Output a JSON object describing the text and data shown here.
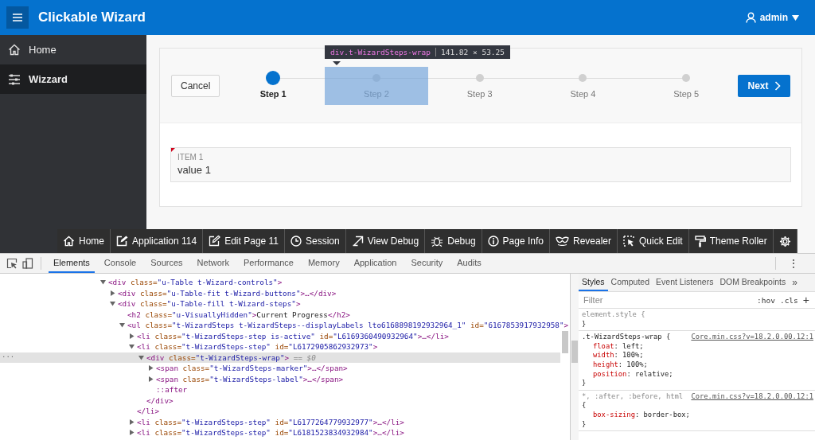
{
  "header": {
    "title": "Clickable Wizard",
    "user": "admin"
  },
  "sidebar": {
    "items": [
      {
        "label": "Home",
        "selected": false
      },
      {
        "label": "Wizzard",
        "selected": true
      }
    ]
  },
  "wizard": {
    "cancel": "Cancel",
    "next": "Next",
    "steps": [
      {
        "label": "Step 1",
        "selected": true,
        "highlighted": false
      },
      {
        "label": "Step 2",
        "selected": false,
        "highlighted": true
      },
      {
        "label": "Step 3",
        "selected": false,
        "highlighted": false
      },
      {
        "label": "Step 4",
        "selected": false,
        "highlighted": false
      },
      {
        "label": "Step 5",
        "selected": false,
        "highlighted": false
      }
    ],
    "inspector_tooltip": {
      "selector": "div.t-WizardSteps-wrap",
      "size": "141.82 × 53.25"
    }
  },
  "form": {
    "label": "ITEM 1",
    "value": "value 1"
  },
  "developer_toolbar": [
    {
      "label": "Home"
    },
    {
      "label": "Application 114"
    },
    {
      "label": "Edit Page 11"
    },
    {
      "label": "Session"
    },
    {
      "label": "View Debug"
    },
    {
      "label": "Debug"
    },
    {
      "label": "Page Info"
    },
    {
      "label": "Revealer"
    },
    {
      "label": "Quick Edit"
    },
    {
      "label": "Theme Roller"
    }
  ],
  "devtools": {
    "tabs": [
      {
        "label": "Elements",
        "selected": true
      },
      {
        "label": "Console",
        "selected": false
      },
      {
        "label": "Sources",
        "selected": false
      },
      {
        "label": "Network",
        "selected": false
      },
      {
        "label": "Performance",
        "selected": false
      },
      {
        "label": "Memory",
        "selected": false
      },
      {
        "label": "Application",
        "selected": false
      },
      {
        "label": "Security",
        "selected": false
      },
      {
        "label": "Audits",
        "selected": false
      }
    ],
    "more": "⋮",
    "dom_tree": [
      {
        "expanded": true,
        "selected": false,
        "tokens": [
          {
            "kind": "tag",
            "text": "<div"
          },
          {
            "kind": "attr",
            "text": " class="
          },
          {
            "kind": "value",
            "text": "\"u-Table t-Wizard-controls\""
          },
          {
            "kind": "tag",
            "text": ">"
          }
        ],
        "children": [
          {
            "expanded": false,
            "selected": false,
            "tokens": [
              {
                "kind": "tag",
                "text": "<div"
              },
              {
                "kind": "attr",
                "text": " class="
              },
              {
                "kind": "value",
                "text": "\"u-Table-fit t-Wizard-buttons\""
              },
              {
                "kind": "tag",
                "text": ">…</div>"
              }
            ]
          },
          {
            "expanded": true,
            "selected": false,
            "tokens": [
              {
                "kind": "tag",
                "text": "<div"
              },
              {
                "kind": "attr",
                "text": " class="
              },
              {
                "kind": "value",
                "text": "\"u-Table-fill t-Wizard-steps\""
              },
              {
                "kind": "tag",
                "text": ">"
              }
            ],
            "children": [
              {
                "tokens": [
                  {
                    "kind": "tag",
                    "text": "<h2"
                  },
                  {
                    "kind": "attr",
                    "text": " class="
                  },
                  {
                    "kind": "value",
                    "text": "\"u-VisuallyHidden\""
                  },
                  {
                    "kind": "tag",
                    "text": ">"
                  },
                  {
                    "kind": "text",
                    "text": "Current Progress"
                  },
                  {
                    "kind": "tag",
                    "text": "</h2>"
                  }
                ],
                "selected": false
              },
              {
                "expanded": true,
                "selected": false,
                "tokens": [
                  {
                    "kind": "tag",
                    "text": "<ul"
                  },
                  {
                    "kind": "attr",
                    "text": " class="
                  },
                  {
                    "kind": "value",
                    "text": "\"t-WizardSteps t-WizardSteps--displayLabels lto6168898192932964_1\""
                  },
                  {
                    "kind": "attr",
                    "text": " id="
                  },
                  {
                    "kind": "value",
                    "text": "\"6167853917932958\""
                  },
                  {
                    "kind": "tag",
                    "text": ">"
                  }
                ],
                "children": [
                  {
                    "expanded": false,
                    "selected": false,
                    "tokens": [
                      {
                        "kind": "tag",
                        "text": "<li"
                      },
                      {
                        "kind": "attr",
                        "text": " class="
                      },
                      {
                        "kind": "value",
                        "text": "\"t-WizardSteps-step is-active\""
                      },
                      {
                        "kind": "attr",
                        "text": " id="
                      },
                      {
                        "kind": "value",
                        "text": "\"L6169360490932964\""
                      },
                      {
                        "kind": "tag",
                        "text": ">…</li>"
                      }
                    ]
                  },
                  {
                    "expanded": true,
                    "selected": false,
                    "tokens": [
                      {
                        "kind": "tag",
                        "text": "<li"
                      },
                      {
                        "kind": "attr",
                        "text": " class="
                      },
                      {
                        "kind": "value",
                        "text": "\"t-WizardSteps-step\""
                      },
                      {
                        "kind": "attr",
                        "text": " id="
                      },
                      {
                        "kind": "value",
                        "text": "\"L6172905862932973\""
                      },
                      {
                        "kind": "tag",
                        "text": ">"
                      }
                    ],
                    "close": "</li>",
                    "children": [
                      {
                        "expanded": true,
                        "selected": true,
                        "tokens": [
                          {
                            "kind": "tag",
                            "text": "<div"
                          },
                          {
                            "kind": "attr",
                            "text": " class="
                          },
                          {
                            "kind": "value",
                            "text": "\"t-WizardSteps-wrap\""
                          },
                          {
                            "kind": "tag",
                            "text": ">"
                          },
                          {
                            "kind": "dim",
                            "text": " == $0"
                          }
                        ],
                        "close": "</div>",
                        "children": [
                          {
                            "expanded": false,
                            "selected": false,
                            "tokens": [
                              {
                                "kind": "tag",
                                "text": "<span"
                              },
                              {
                                "kind": "attr",
                                "text": " class="
                              },
                              {
                                "kind": "value",
                                "text": "\"t-WizardSteps-marker\""
                              },
                              {
                                "kind": "tag",
                                "text": ">…</span>"
                              }
                            ]
                          },
                          {
                            "expanded": false,
                            "selected": false,
                            "tokens": [
                              {
                                "kind": "tag",
                                "text": "<span"
                              },
                              {
                                "kind": "attr",
                                "text": " class="
                              },
                              {
                                "kind": "value",
                                "text": "\"t-WizardSteps-label\""
                              },
                              {
                                "kind": "tag",
                                "text": ">…</span>"
                              }
                            ]
                          },
                          {
                            "selected": false,
                            "tokens": [
                              {
                                "kind": "pseudo",
                                "text": "::after"
                              }
                            ]
                          }
                        ]
                      }
                    ]
                  },
                  {
                    "expanded": false,
                    "selected": false,
                    "tokens": [
                      {
                        "kind": "tag",
                        "text": "<li"
                      },
                      {
                        "kind": "attr",
                        "text": " class="
                      },
                      {
                        "kind": "value",
                        "text": "\"t-WizardSteps-step\""
                      },
                      {
                        "kind": "attr",
                        "text": " id="
                      },
                      {
                        "kind": "value",
                        "text": "\"L6177264779932977\""
                      },
                      {
                        "kind": "tag",
                        "text": ">…</li>"
                      }
                    ]
                  },
                  {
                    "expanded": false,
                    "selected": false,
                    "tokens": [
                      {
                        "kind": "tag",
                        "text": "<li"
                      },
                      {
                        "kind": "attr",
                        "text": " class="
                      },
                      {
                        "kind": "value",
                        "text": "\"t-WizardSteps-step\""
                      },
                      {
                        "kind": "attr",
                        "text": " id="
                      },
                      {
                        "kind": "value",
                        "text": "\"L6181523834932984\""
                      },
                      {
                        "kind": "tag",
                        "text": ">…</li>"
                      }
                    ]
                  }
                ]
              }
            ]
          }
        ]
      }
    ],
    "selected_marker": "...",
    "styles": {
      "tabs": [
        {
          "label": "Styles",
          "selected": true
        },
        {
          "label": "Computed",
          "selected": false
        },
        {
          "label": "Event Listeners",
          "selected": false
        },
        {
          "label": "DOM Breakpoints",
          "selected": false
        }
      ],
      "overflow": "»",
      "filter_placeholder": "Filter",
      "hov": ":hov",
      "cls": ".cls",
      "add": "+",
      "rules": [
        {
          "selector": "element.style {",
          "close": "}",
          "dim": true
        },
        {
          "selector": ".t-WizardSteps-wrap {",
          "source": "Core.min.css?v=18.2.0.00.12:1",
          "declarations": [
            {
              "property": "float",
              "value": ": left;"
            },
            {
              "property": "width",
              "value": ": 100%;"
            },
            {
              "property": "height",
              "value": ": 100%;"
            },
            {
              "property": "position",
              "value": ": relative;"
            }
          ],
          "close": "}",
          "dim": false
        },
        {
          "selector": "*, :after, :before, html",
          "source": "Core.min.css?v=18.2.0.00.12:1",
          "open": "{",
          "declarations": [
            {
              "property": "box-sizing",
              "value": ": border-box;"
            }
          ],
          "close": "}",
          "dim": true
        }
      ]
    }
  }
}
